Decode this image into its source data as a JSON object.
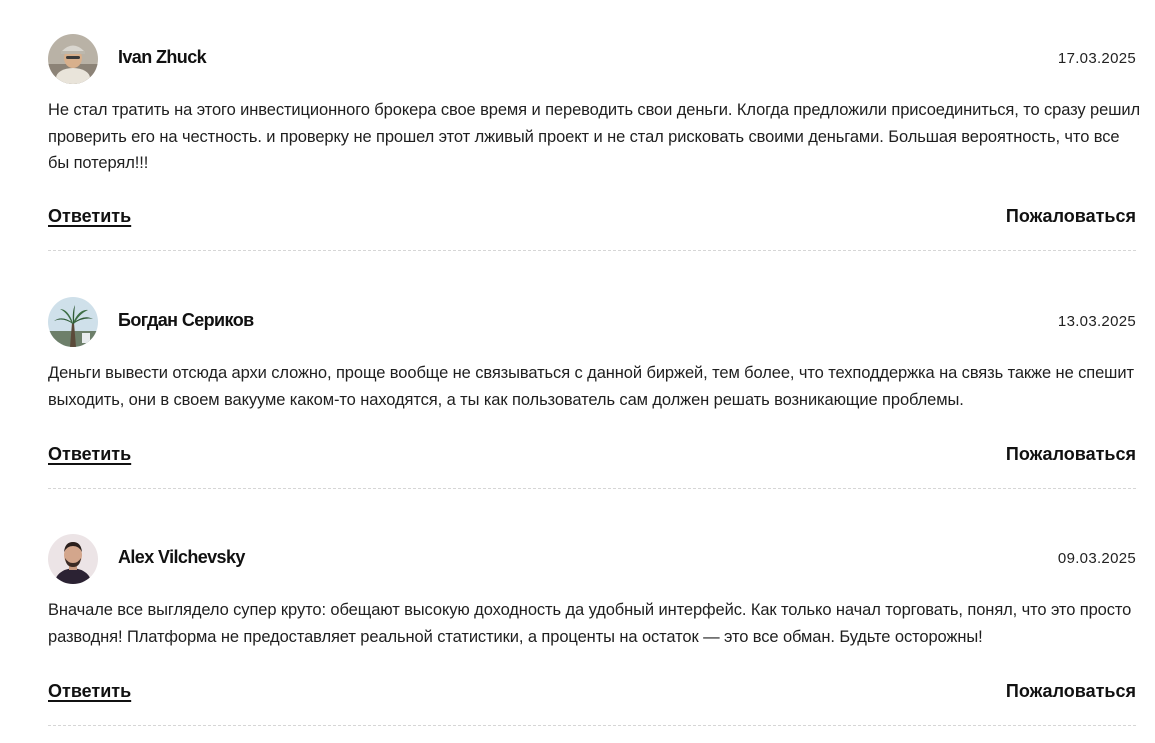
{
  "comments": [
    {
      "author": "Ivan Zhuck",
      "date": "17.03.2025",
      "text": "Не стал тратить на этого инвестиционного брокера свое время и переводить свои деньги. Клогда предложили присоединиться, то сразу решил проверить его на честность. и проверку не прошел этот лживый проект и не стал рисковать своими деньгами. Большая вероятность, что все бы потерял!!!",
      "reply_label": "Ответить",
      "report_label": "Пожаловаться"
    },
    {
      "author": "Богдан Сериков",
      "date": "13.03.2025",
      "text": "Деньги вывести отсюда архи сложно, проще вообще не связываться с данной биржей, тем более, что техподдержка на связь также не спешит выходить, они в своем вакууме каком-то находятся, а ты как пользователь сам должен решать возникающие проблемы.",
      "reply_label": "Ответить",
      "report_label": "Пожаловаться"
    },
    {
      "author": "Alex Vilchevsky",
      "date": "09.03.2025",
      "text": "Вначале все выглядело супер круто: обещают высокую доходность да удобный интерфейс. Как только начал торговать, понял, что это просто разводня! Платформа не предоставляет реальной статистики, а проценты на остаток — это все обман. Будьте осторожны!",
      "reply_label": "Ответить",
      "report_label": "Пожаловаться"
    }
  ]
}
